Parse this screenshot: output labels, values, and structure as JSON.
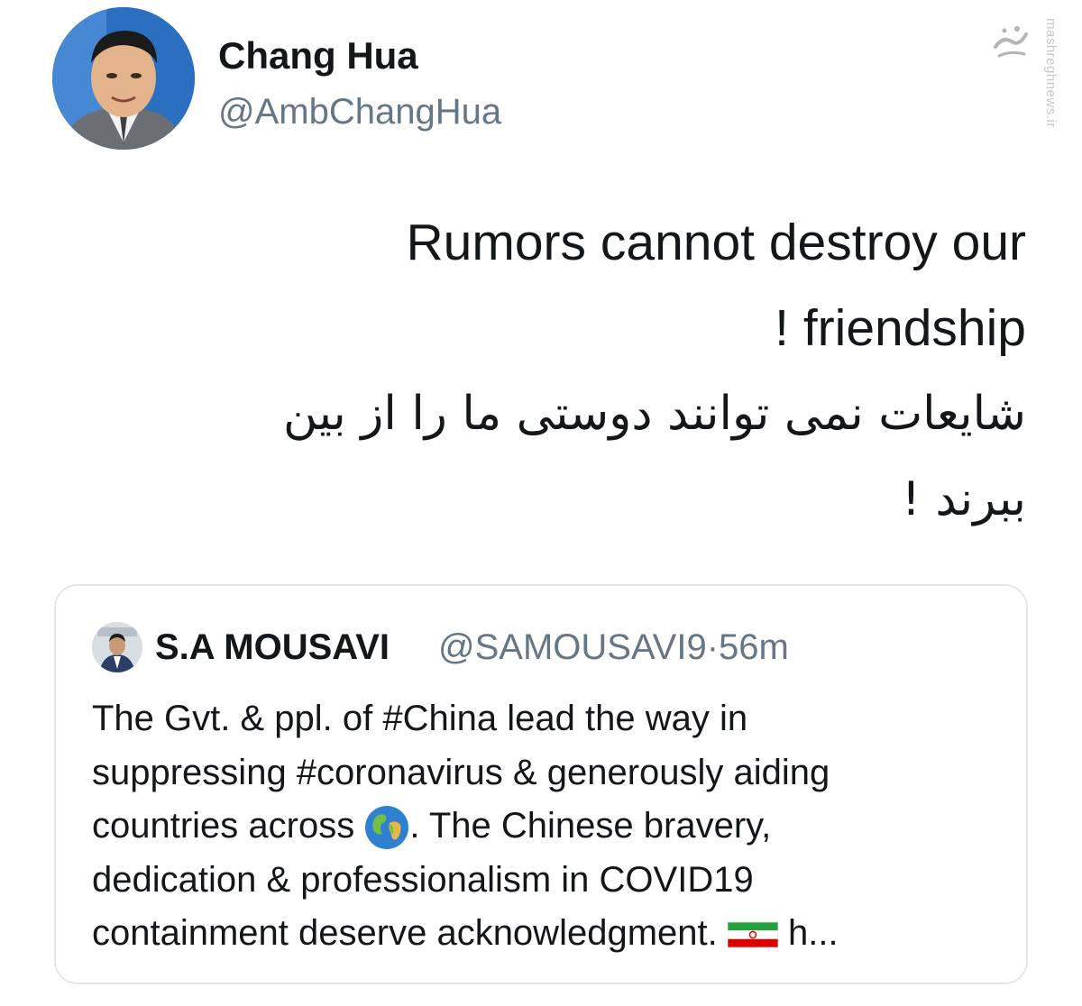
{
  "tweet": {
    "author": {
      "display_name": "Chang Hua",
      "handle": "@AmbChangHua",
      "avatar_icon": "profile-photo"
    },
    "text_lines": [
      "Rumors cannot destroy our",
      "! friendship",
      "شایعات نمی توانند دوستی ما را از بین",
      "ببرند !"
    ]
  },
  "watermark": {
    "site": "mashreghnews.ir",
    "logo_icon": "mashregh-logo"
  },
  "quoted_tweet": {
    "author": {
      "display_name": "S.A MOUSAVI",
      "handle": "@SAMOUSAVI9",
      "separator": "·",
      "time": "56m",
      "avatar_icon": "profile-photo"
    },
    "lines": [
      {
        "text": "The Gvt. & ppl. of #China lead the way in"
      },
      {
        "text": "suppressing #coronavirus & generously aiding"
      },
      {
        "text": "countries across",
        "emoji": "globe-emoji",
        "text_after": ". The Chinese bravery,"
      },
      {
        "text": "dedication & professionalism in COVID19"
      },
      {
        "text": "containment deserve acknowledgment.",
        "emoji": "iran-flag-emoji",
        "text_after": "h..."
      }
    ]
  },
  "colors": {
    "text": "#14171a",
    "secondary": "#657786",
    "border": "#e1e8ed"
  }
}
